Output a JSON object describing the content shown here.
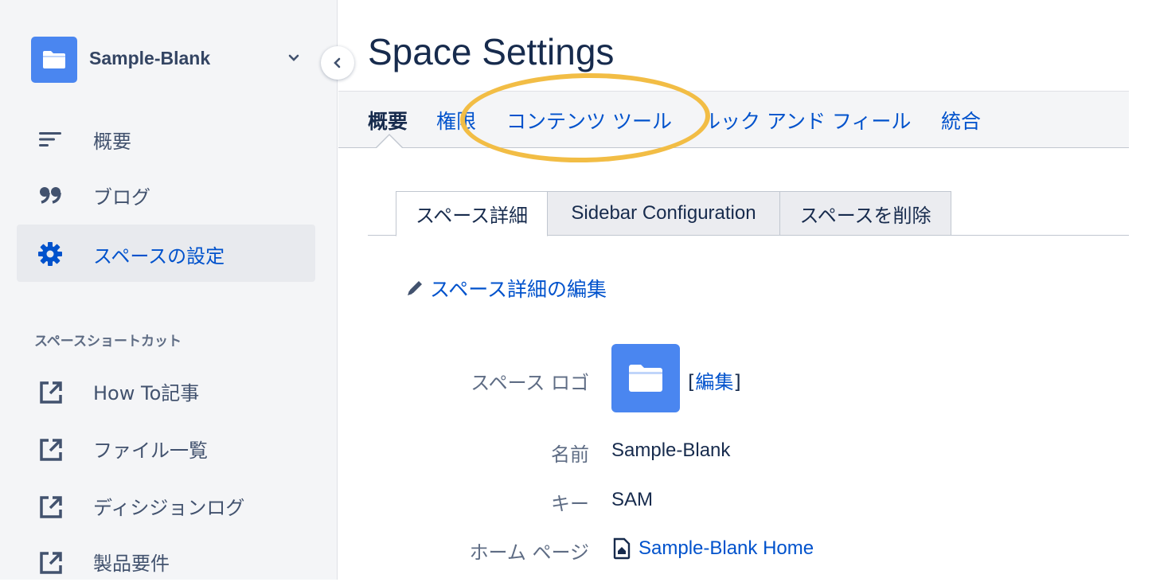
{
  "sidebar": {
    "space_name": "Sample-Blank",
    "nav": [
      {
        "label": "概要",
        "icon": "overview-lines-icon"
      },
      {
        "label": "ブログ",
        "icon": "quote-icon"
      },
      {
        "label": "スペースの設定",
        "icon": "gear-icon",
        "active": true
      }
    ],
    "shortcuts_heading": "スペースショートカット",
    "shortcuts": [
      {
        "label": "How To記事"
      },
      {
        "label": "ファイル一覧"
      },
      {
        "label": "ディシジョンログ"
      },
      {
        "label": "製品要件"
      }
    ]
  },
  "page": {
    "title": "Space Settings",
    "tabs": [
      {
        "label": "概要",
        "active": true
      },
      {
        "label": "権限"
      },
      {
        "label": "コンテンツ ツール"
      },
      {
        "label": "ルック アンド フィール"
      },
      {
        "label": "統合"
      }
    ],
    "sub_tabs": [
      {
        "label": "スペース詳細",
        "active": true
      },
      {
        "label": "Sidebar Configuration"
      },
      {
        "label": "スペースを削除"
      }
    ],
    "edit_link": "スペース詳細の編集",
    "details": {
      "logo_label": "スペース ロゴ",
      "logo_edit_open": "[",
      "logo_edit": "編集",
      "logo_edit_close": "]",
      "name_label": "名前",
      "name_value": "Sample-Blank",
      "key_label": "キー",
      "key_value": "SAM",
      "home_label": "ホーム ページ",
      "home_value": "Sample-Blank Home"
    }
  },
  "colors": {
    "accent": "#0052cc",
    "logo": "#4a86f0",
    "highlight": "#f2bd45"
  }
}
